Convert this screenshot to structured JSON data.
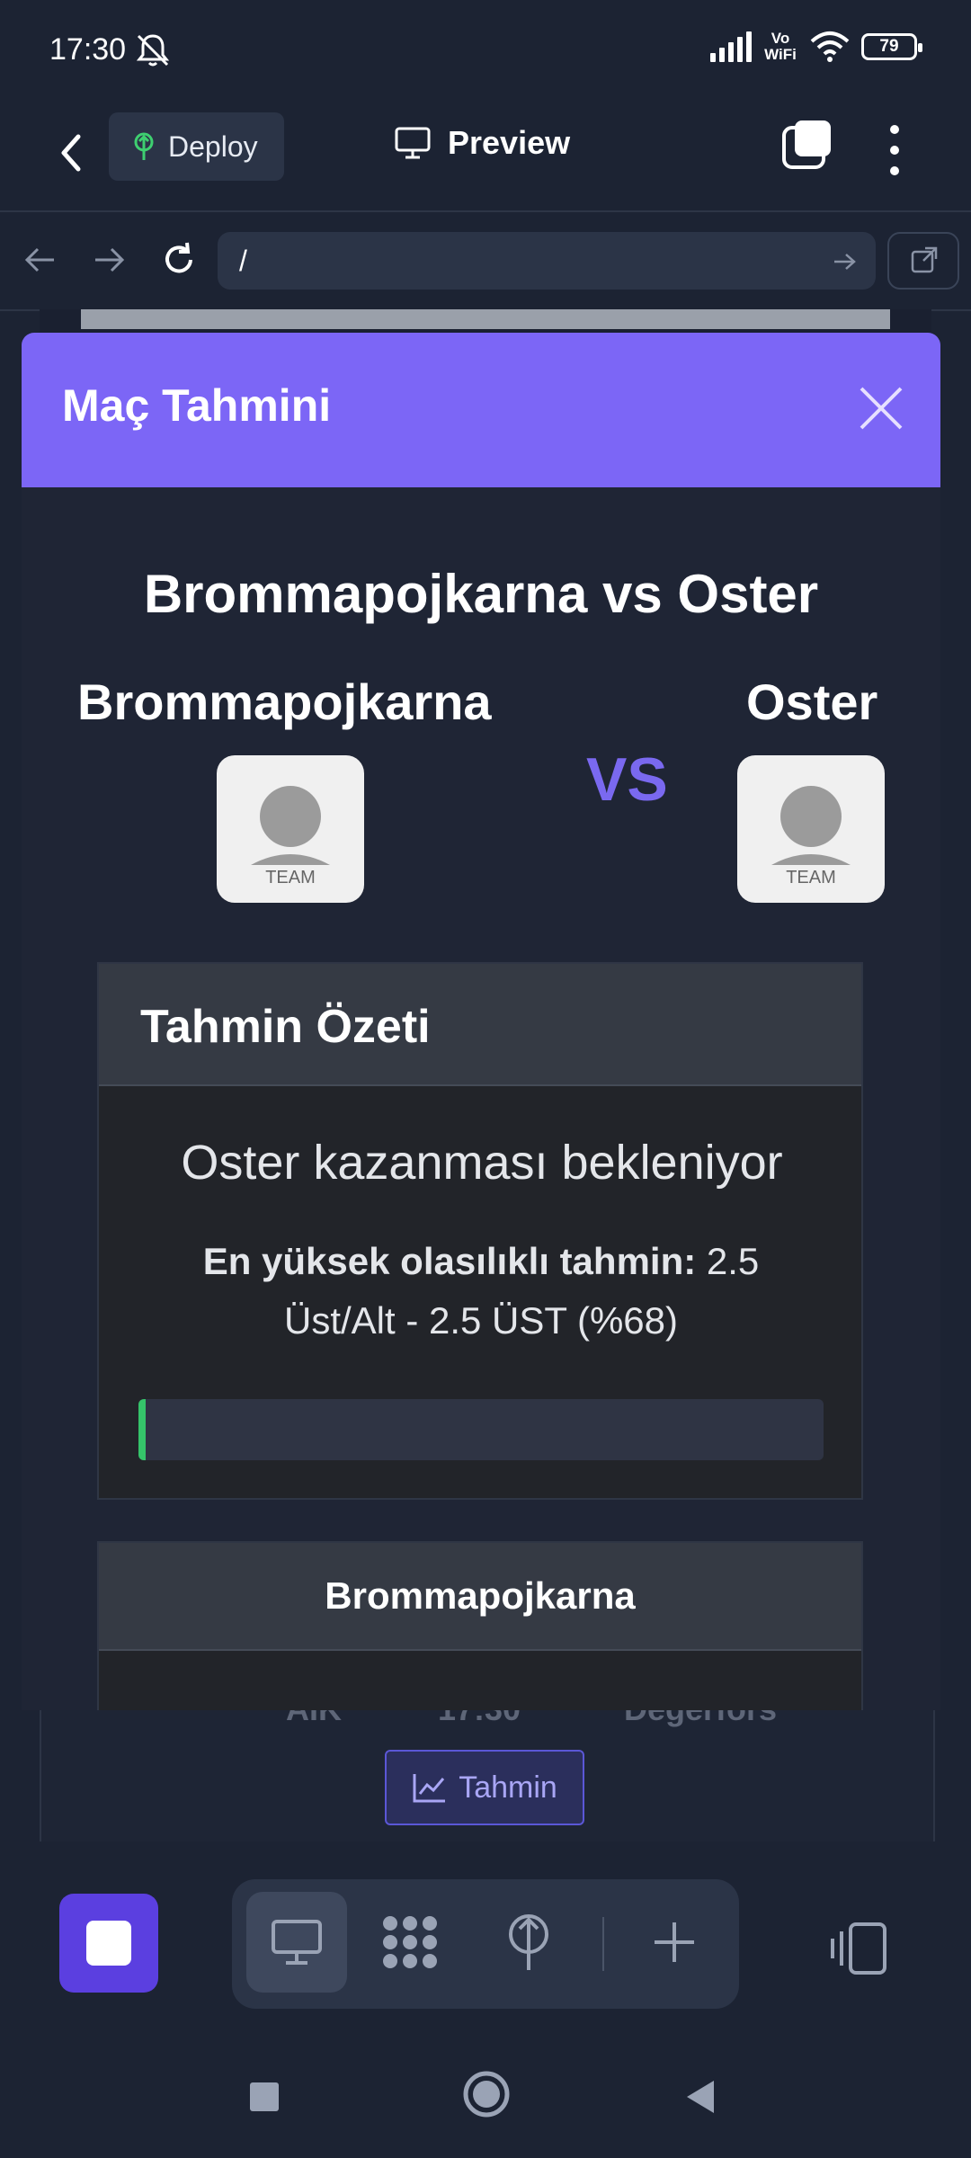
{
  "status_bar": {
    "time": "17:30",
    "network": "Vo WiFi",
    "battery": "79"
  },
  "app_header": {
    "deploy_label": "Deploy",
    "preview_label": "Preview"
  },
  "url_bar": {
    "url": "/"
  },
  "background_page": {
    "peek_text": "AIK",
    "peek_time": "17:30",
    "peek_away": "Degerfors",
    "tahmin_button": "Tahmin"
  },
  "modal": {
    "title": "Maç Tahmini",
    "match_title": "Brommapojkarna vs Oster",
    "home_team": "Brommapojkarna",
    "away_team": "Oster",
    "vs_label": "VS",
    "team_logo_label": "TEAM",
    "summary": {
      "title": "Tahmin Özeti",
      "expectation": "Oster kazanması bekleniyor",
      "best_label": "En yüksek olasılıklı tahmin:",
      "best_value": "2.5 Üst/Alt - 2.5 ÜST (%68)",
      "progress_fraction": 0.01
    },
    "team_card_title": "Brommapojkarna"
  },
  "colors": {
    "accent": "#7c66f6",
    "stop": "#5b3fe0",
    "progress": "#35c46a",
    "vs": "#7a69f0"
  }
}
